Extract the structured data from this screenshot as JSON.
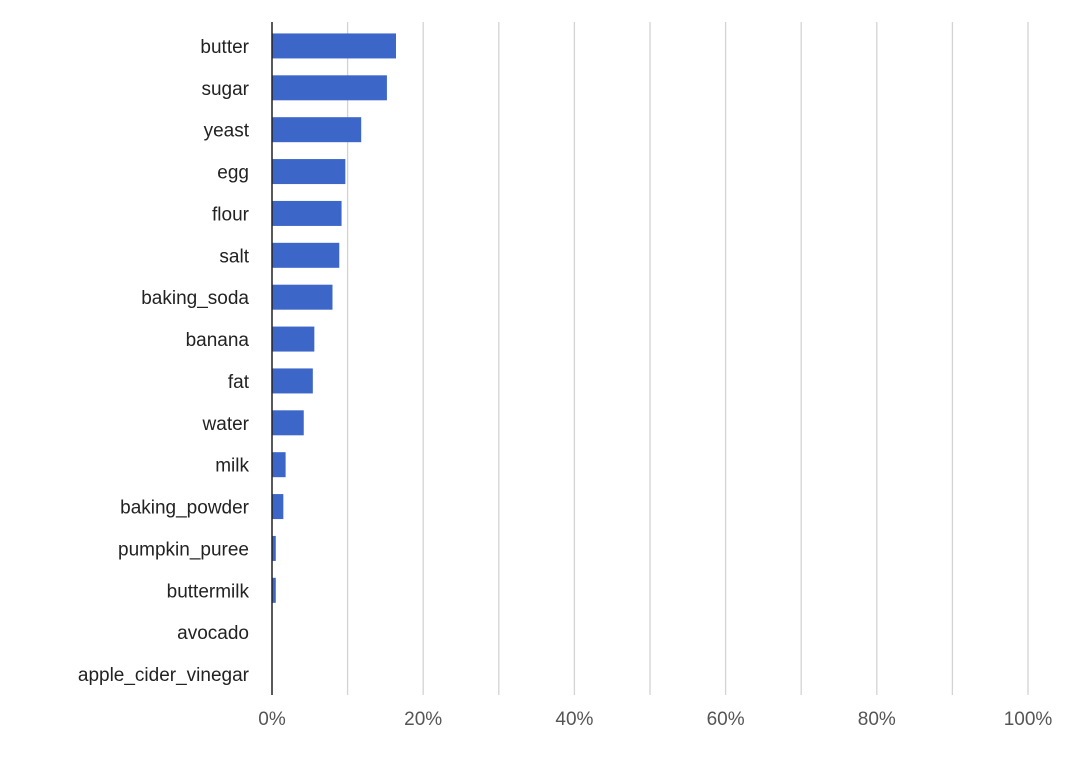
{
  "chart_data": {
    "type": "bar",
    "orientation": "horizontal",
    "title": "",
    "xlabel": "",
    "ylabel": "",
    "categories": [
      "butter",
      "sugar",
      "yeast",
      "egg",
      "flour",
      "salt",
      "baking_soda",
      "banana",
      "fat",
      "water",
      "milk",
      "baking_powder",
      "pumpkin_puree",
      "buttermilk",
      "avocado",
      "apple_cider_vinegar"
    ],
    "values": [
      16.4,
      15.2,
      11.8,
      9.7,
      9.2,
      8.9,
      8.0,
      5.6,
      5.4,
      4.2,
      1.8,
      1.5,
      0.5,
      0.5,
      0,
      0
    ],
    "xlim": [
      0,
      100
    ],
    "x_ticks": [
      0,
      20,
      40,
      60,
      80,
      100
    ],
    "x_tick_labels": [
      "0%",
      "20%",
      "40%",
      "60%",
      "80%",
      "100%"
    ],
    "grid": "vertical, every 10%",
    "legend": "none",
    "colors": {
      "bar": "#3c66c7",
      "grid": "#d3d3d3",
      "axis": "#222222",
      "label": "#222222",
      "tick": "#555555"
    }
  }
}
